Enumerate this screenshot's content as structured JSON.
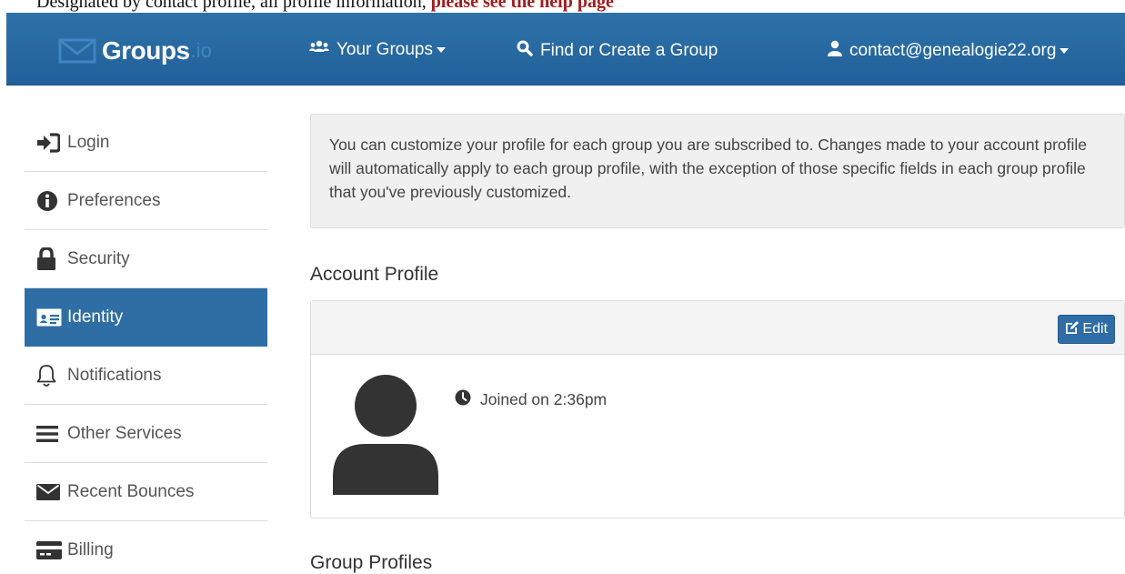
{
  "top_strip": {
    "text_before": "Designated by contact profile, all profile information,",
    "text_red": "please see the help page"
  },
  "navbar": {
    "brand_name": "Groups",
    "brand_tld": ".io",
    "your_groups_label": "Your Groups",
    "find_label": "Find or Create a Group",
    "account_label": "contact@genealogie22.org",
    "colors": {
      "bar": "#2e72a9",
      "text": "#ffffff"
    }
  },
  "sidebar": {
    "items": [
      {
        "label": "Login",
        "icon": "sign-in-icon"
      },
      {
        "label": "Preferences",
        "icon": "info-circle-icon"
      },
      {
        "label": "Security",
        "icon": "lock-icon"
      },
      {
        "label": "Identity",
        "icon": "id-card-icon",
        "active": true
      },
      {
        "label": "Notifications",
        "icon": "bell-icon"
      },
      {
        "label": "Other Services",
        "icon": "bars-icon"
      },
      {
        "label": "Recent Bounces",
        "icon": "envelope-icon"
      },
      {
        "label": "Billing",
        "icon": "credit-card-icon"
      }
    ],
    "active_color": "#2e6ea5"
  },
  "main": {
    "alert_text": "You can customize your profile for each group you are subscribed to. Changes made to your account profile will automatically apply to each group profile, with the exception of those specific fields in each group profile that you've previously customized.",
    "account_profile_title": "Account Profile",
    "edit_label": "Edit",
    "joined_text": "Joined on 2:36pm",
    "group_profiles_title": "Group Profiles"
  }
}
